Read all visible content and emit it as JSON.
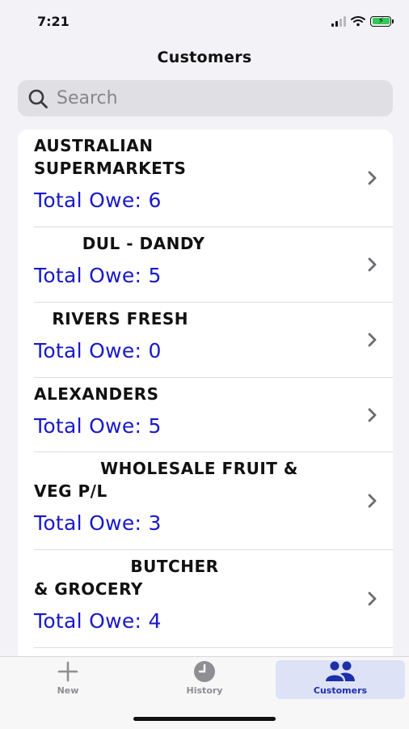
{
  "status": {
    "time": "7:21"
  },
  "nav": {
    "title": "Customers"
  },
  "search": {
    "placeholder": "Search"
  },
  "customers": [
    {
      "name": "AUSTRALIAN\nSUPERMARKETS",
      "owe": "Total Owe: 6"
    },
    {
      "name": "        DUL - DANDY",
      "owe": "Total Owe: 5"
    },
    {
      "name": "   RIVERS FRESH",
      "owe": "Total Owe: 0"
    },
    {
      "name": "ALEXANDERS",
      "owe": "Total Owe: 5"
    },
    {
      "name": "           WHOLESALE FRUIT &\nVEG P/L",
      "owe": "Total Owe: 3"
    },
    {
      "name": "                BUTCHER\n& GROCERY",
      "owe": "Total Owe: 4"
    }
  ],
  "tabbar": {
    "tabs": [
      {
        "label": "New",
        "icon": "plus-icon"
      },
      {
        "label": "History",
        "icon": "clock-icon"
      },
      {
        "label": "Customers",
        "icon": "people-icon"
      }
    ],
    "active": "Customers"
  },
  "colors": {
    "owe_text": "#1919c8",
    "active_tab": "#1d2fa8",
    "active_tab_bg": "#dde2f7"
  }
}
